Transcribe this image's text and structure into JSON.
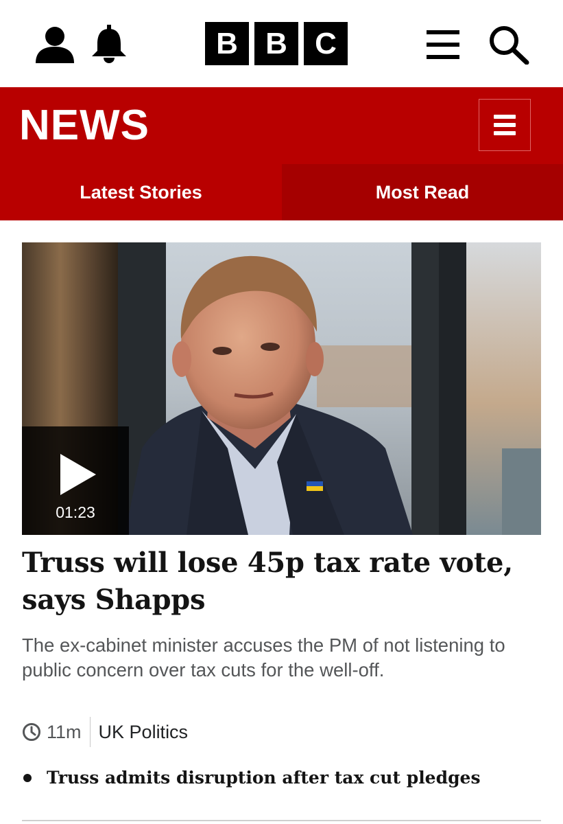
{
  "header": {
    "logo_letters": [
      "B",
      "B",
      "C"
    ],
    "icons": [
      "account-icon",
      "bell-icon",
      "menu-icon",
      "search-icon"
    ]
  },
  "news": {
    "title": "NEWS",
    "menu_icon": "hamburger-icon",
    "brand_color": "#b80000",
    "tabs": [
      {
        "label": "Latest Stories",
        "selected": true
      },
      {
        "label": "Most Read",
        "selected": false
      }
    ]
  },
  "article": {
    "video_duration": "01:23",
    "headline": "Truss will lose 45p tax rate vote, says Shapps",
    "summary": "The ex-cabinet minister accuses the PM of not listening to public concern over tax cuts for the well-off.",
    "time_ago": "11m",
    "section": "UK Politics",
    "related": "Truss admits disruption after tax cut pledges"
  }
}
